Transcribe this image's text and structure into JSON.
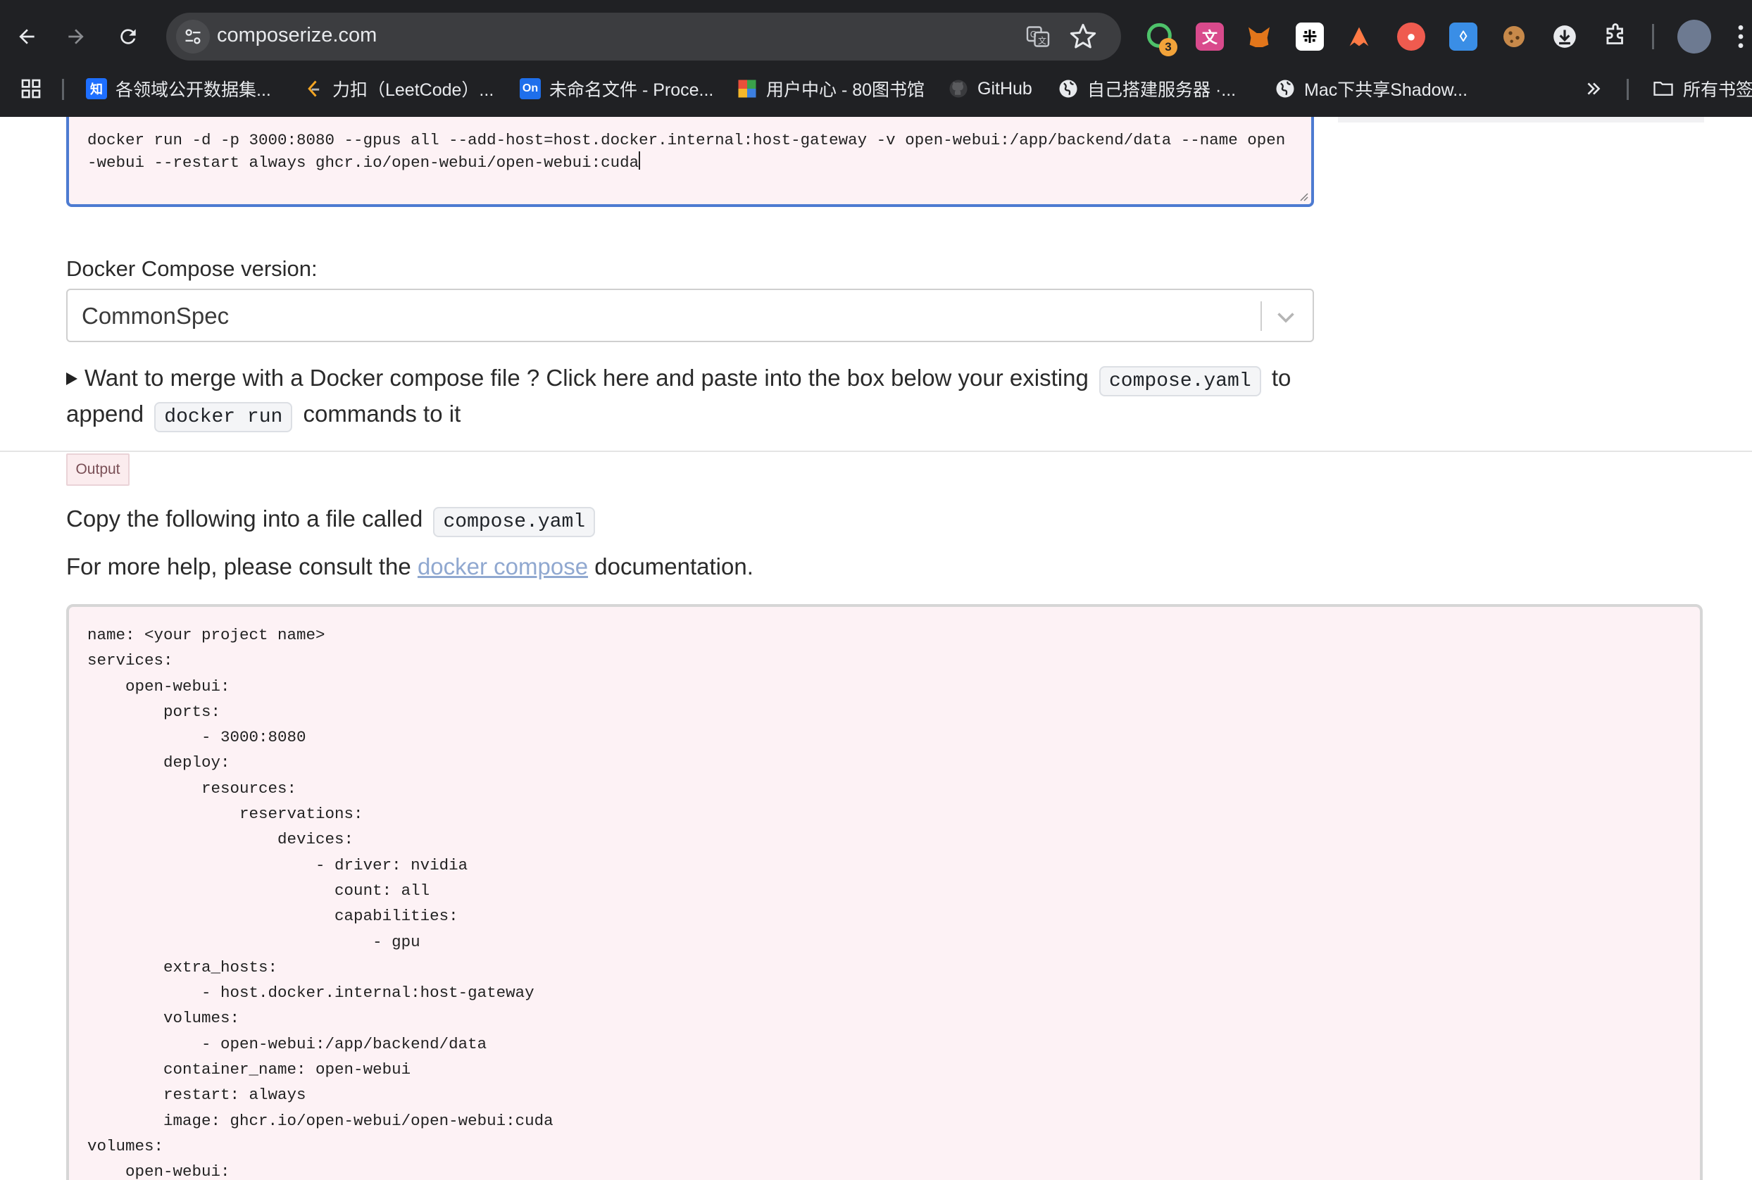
{
  "browser": {
    "url": "composerize.com",
    "extension_badge": "3",
    "bookmarks": [
      {
        "label": "各领域公开数据集...",
        "icon": "zhihu-icon",
        "icon_text": "知",
        "color": "#1e6fff"
      },
      {
        "label": "力扣（LeetCode）...",
        "icon": "leetcode-icon",
        "icon_text": "",
        "color": "#202124"
      },
      {
        "label": "未命名文件 - Proce...",
        "icon": "processon-icon",
        "icon_text": "On",
        "color": "#1f6feb"
      },
      {
        "label": "用户中心 - 80图书馆",
        "icon": "library-icon",
        "icon_text": "",
        "color": "#202124"
      },
      {
        "label": "GitHub",
        "icon": "github-icon",
        "icon_text": "",
        "color": "#202124"
      },
      {
        "label": "自己搭建服务器 ·...",
        "icon": "globe-icon",
        "icon_text": "",
        "color": "#202124"
      },
      {
        "label": "Mac下共享Shadow...",
        "icon": "globe-icon",
        "icon_text": "",
        "color": "#202124"
      }
    ],
    "all_bookmarks_label": "所有书签"
  },
  "form": {
    "command_text": "docker run -d -p 3000:8080 --gpus all --add-host=host.docker.internal:host-gateway -v open-webui:/app/backend/data --name open-webui --restart always ghcr.io/open-webui/open-webui:cuda",
    "version_label": "Docker Compose version:",
    "version_value": "CommonSpec",
    "merge": {
      "text_before": "Want to merge with a Docker compose file ? Click here and paste into the box below your existing",
      "code1": "compose.yaml",
      "text_middle": "to append",
      "code2": "docker run",
      "text_after": "commands to it"
    }
  },
  "output": {
    "tab_label": "Output",
    "copy_prefix": "Copy the following into a file called",
    "copy_code": "compose.yaml",
    "help_prefix": "For more help, please consult the",
    "help_link": "docker compose",
    "help_suffix": "documentation.",
    "yaml_lines": [
      "name: <your project name>",
      "services:",
      "    open-webui:",
      "        ports:",
      "            - 3000:8080",
      "        deploy:",
      "            resources:",
      "                reservations:",
      "                    devices:",
      "                        - driver: nvidia",
      "                          count: all",
      "                          capabilities:",
      "                              - gpu",
      "        extra_hosts:",
      "            - host.docker.internal:host-gateway",
      "        volumes:",
      "            - open-webui:/app/backend/data",
      "        container_name: open-webui",
      "        restart: always",
      "        image: ghcr.io/open-webui/open-webui:cuda",
      "volumes:",
      "    open-webui:"
    ]
  }
}
